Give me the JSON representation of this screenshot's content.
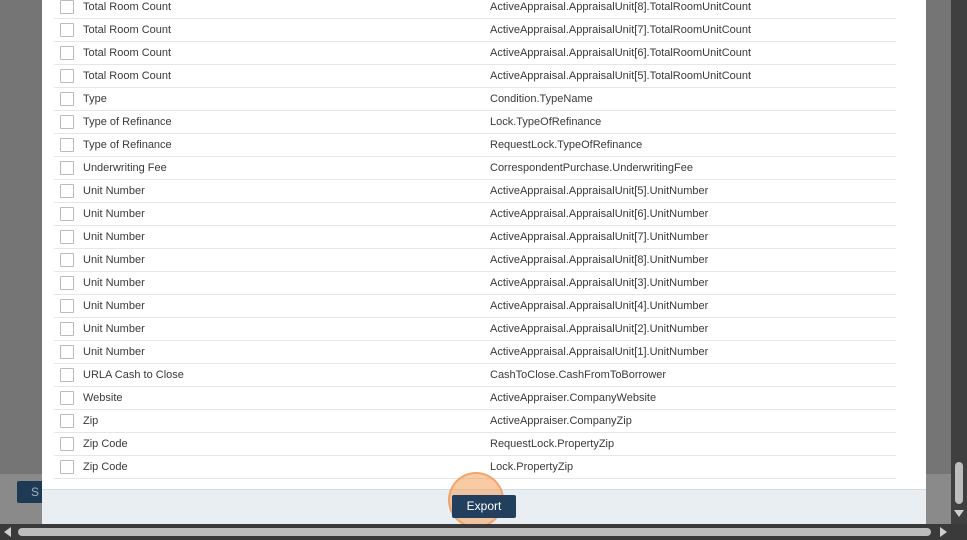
{
  "fields_table": {
    "rows": [
      {
        "label": "Total Room Count",
        "path": "ActiveAppraisal.AppraisalUnit[8].TotalRoomUnitCount",
        "checked": false
      },
      {
        "label": "Total Room Count",
        "path": "ActiveAppraisal.AppraisalUnit[7].TotalRoomUnitCount",
        "checked": false
      },
      {
        "label": "Total Room Count",
        "path": "ActiveAppraisal.AppraisalUnit[6].TotalRoomUnitCount",
        "checked": false
      },
      {
        "label": "Total Room Count",
        "path": "ActiveAppraisal.AppraisalUnit[5].TotalRoomUnitCount",
        "checked": false
      },
      {
        "label": "Type",
        "path": "Condition.TypeName",
        "checked": false
      },
      {
        "label": "Type of Refinance",
        "path": "Lock.TypeOfRefinance",
        "checked": false
      },
      {
        "label": "Type of Refinance",
        "path": "RequestLock.TypeOfRefinance",
        "checked": false
      },
      {
        "label": "Underwriting Fee",
        "path": "CorrespondentPurchase.UnderwritingFee",
        "checked": false
      },
      {
        "label": "Unit Number",
        "path": "ActiveAppraisal.AppraisalUnit[5].UnitNumber",
        "checked": false
      },
      {
        "label": "Unit Number",
        "path": "ActiveAppraisal.AppraisalUnit[6].UnitNumber",
        "checked": false
      },
      {
        "label": "Unit Number",
        "path": "ActiveAppraisal.AppraisalUnit[7].UnitNumber",
        "checked": false
      },
      {
        "label": "Unit Number",
        "path": "ActiveAppraisal.AppraisalUnit[8].UnitNumber",
        "checked": false
      },
      {
        "label": "Unit Number",
        "path": "ActiveAppraisal.AppraisalUnit[3].UnitNumber",
        "checked": false
      },
      {
        "label": "Unit Number",
        "path": "ActiveAppraisal.AppraisalUnit[4].UnitNumber",
        "checked": false
      },
      {
        "label": "Unit Number",
        "path": "ActiveAppraisal.AppraisalUnit[2].UnitNumber",
        "checked": false
      },
      {
        "label": "Unit Number",
        "path": "ActiveAppraisal.AppraisalUnit[1].UnitNumber",
        "checked": false
      },
      {
        "label": "URLA Cash to Close",
        "path": "CashToClose.CashFromToBorrower",
        "checked": false
      },
      {
        "label": "Website",
        "path": "ActiveAppraiser.CompanyWebsite",
        "checked": false
      },
      {
        "label": "Zip",
        "path": "ActiveAppraiser.CompanyZip",
        "checked": false
      },
      {
        "label": "Zip Code",
        "path": "RequestLock.PropertyZip",
        "checked": false
      },
      {
        "label": "Zip Code",
        "path": "Lock.PropertyZip",
        "checked": false
      }
    ]
  },
  "footer": {
    "export_label": "Export"
  },
  "background": {
    "partial_button_label": "S"
  },
  "colors": {
    "primary_button": "#22405e",
    "highlight": "#f4a05a",
    "footer_bg": "#e9eef3",
    "overlay": "#757575"
  }
}
